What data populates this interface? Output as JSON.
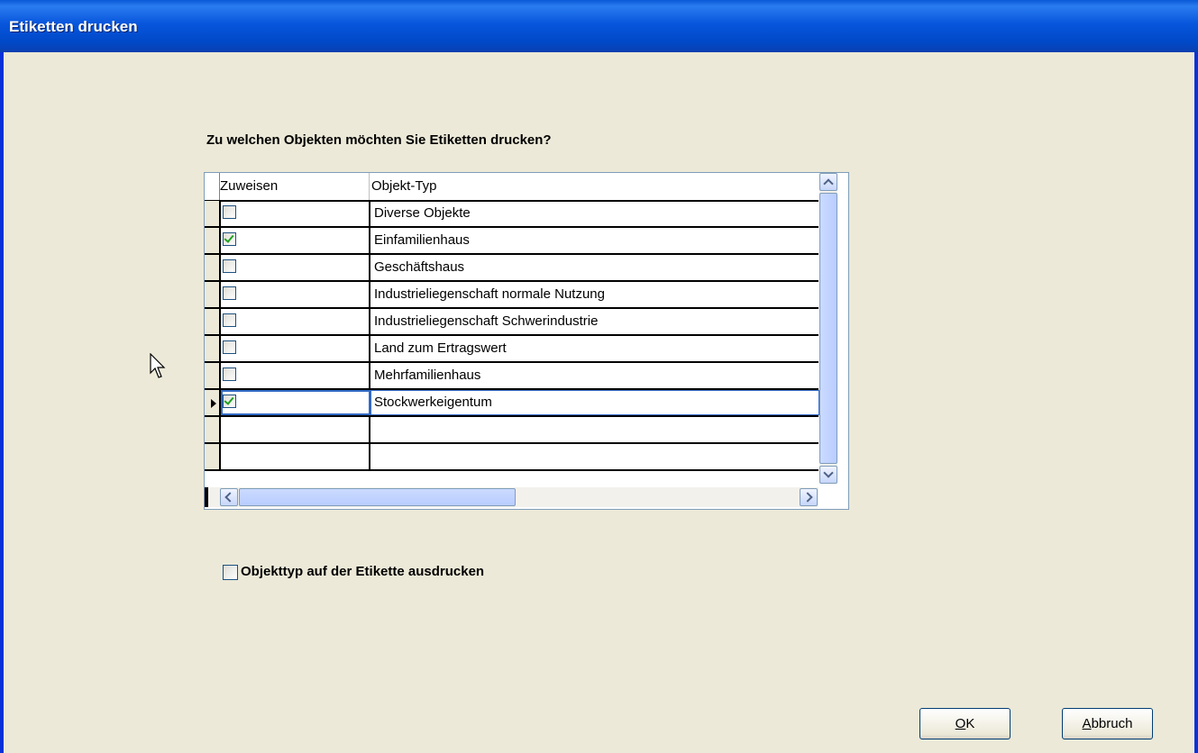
{
  "window": {
    "title": "Etiketten drucken"
  },
  "prompt": "Zu welchen Objekten möchten Sie Etiketten drucken?",
  "grid": {
    "columns": [
      "Zuweisen",
      "Objekt-Typ"
    ],
    "rows": [
      {
        "assigned": false,
        "type": "Diverse Objekte"
      },
      {
        "assigned": true,
        "type": "Einfamilienhaus"
      },
      {
        "assigned": false,
        "type": "Geschäftshaus"
      },
      {
        "assigned": false,
        "type": "Industrieliegenschaft normale Nutzung"
      },
      {
        "assigned": false,
        "type": "Industrieliegenschaft Schwerindustrie"
      },
      {
        "assigned": false,
        "type": "Land zum Ertragswert"
      },
      {
        "assigned": false,
        "type": "Mehrfamilienhaus"
      },
      {
        "assigned": true,
        "type": "Stockwerkeigentum",
        "selected": true
      }
    ]
  },
  "print_option": {
    "label": "Objekttyp auf der Etikette ausdrucken",
    "checked": false
  },
  "buttons": {
    "ok": {
      "accesskey": "O",
      "rest": "K"
    },
    "cancel": {
      "accesskey": "A",
      "rest": "bbruch"
    }
  },
  "colors": {
    "titlebar": "#0a58d6",
    "dialog_bg": "#ece9d8",
    "check": "#21a121",
    "selection": "#316ac5"
  }
}
